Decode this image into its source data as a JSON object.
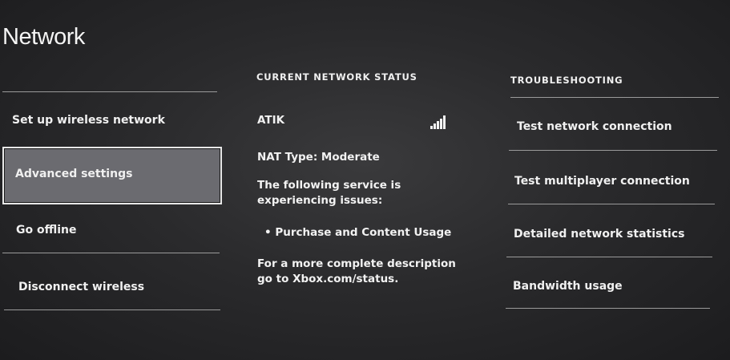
{
  "page": {
    "title": "Network"
  },
  "left_menu": {
    "items": [
      {
        "label": "Set up wireless network"
      },
      {
        "label": "Advanced settings",
        "selected": true
      },
      {
        "label": "Go offline"
      },
      {
        "label": "Disconnect wireless"
      }
    ]
  },
  "status": {
    "heading": "CURRENT NETWORK STATUS",
    "network_name": "ATIK",
    "signal_icon": "signal-strength-icon",
    "nat_type": "NAT Type: Moderate",
    "service_issue": "The following service is experiencing issues:",
    "affected_service": "• Purchase and Content Usage",
    "more_info": "For a more complete description go to Xbox.com/status."
  },
  "troubleshooting": {
    "heading": "TROUBLESHOOTING",
    "items": [
      {
        "label": "Test network connection"
      },
      {
        "label": "Test multiplayer connection"
      },
      {
        "label": "Detailed network statistics"
      },
      {
        "label": "Bandwidth usage"
      }
    ]
  },
  "colors": {
    "background": "#2a2a2c",
    "selected_tile": "#6b6b70",
    "text": "#f2f2f2",
    "divider": "#9a9a9a"
  }
}
